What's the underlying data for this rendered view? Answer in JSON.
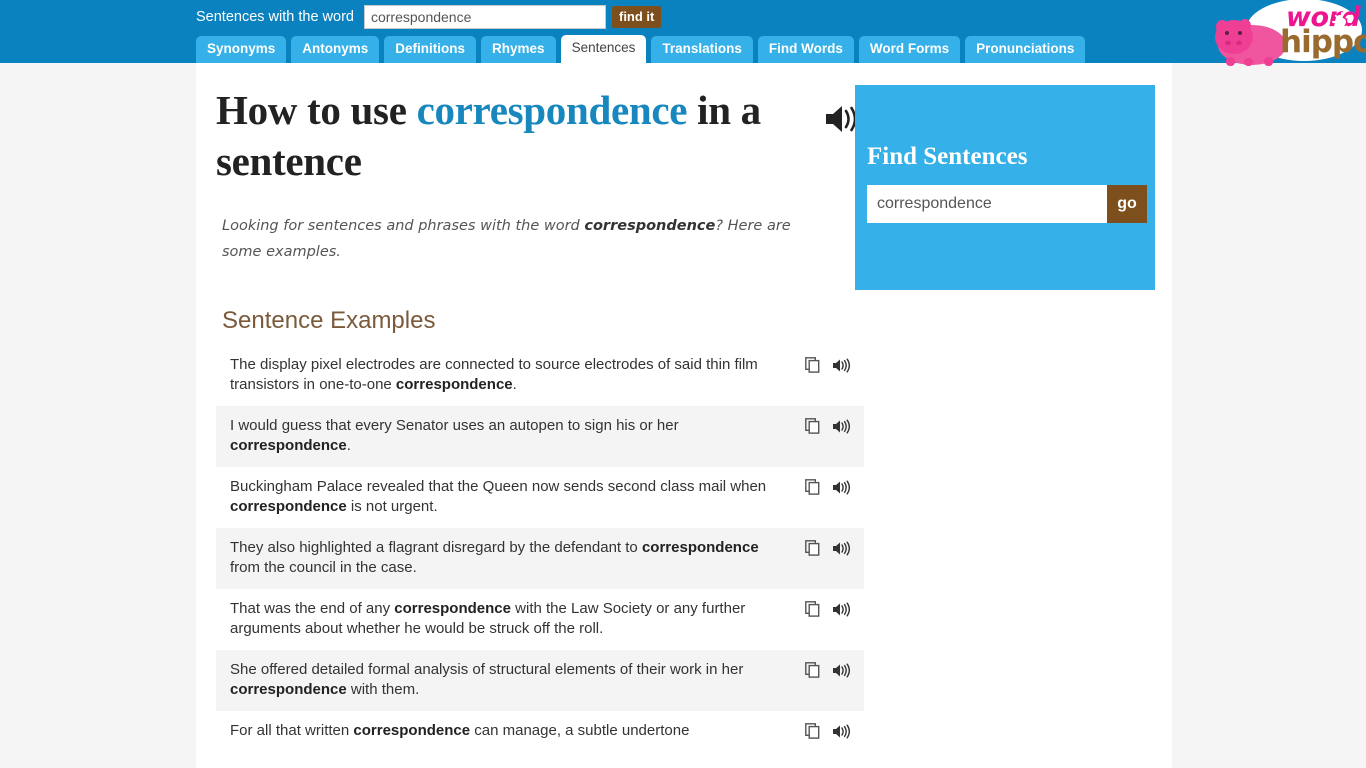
{
  "header": {
    "search_label": "Sentences with the word",
    "search_value": "correspondence",
    "search_placeholder": "correspondence",
    "find_button": "find it",
    "brightness_icon": "sun-icon",
    "logo": {
      "word": "word",
      "hippo": "hippo"
    },
    "tabs": [
      {
        "label": "Synonyms",
        "active": false
      },
      {
        "label": "Antonyms",
        "active": false
      },
      {
        "label": "Definitions",
        "active": false
      },
      {
        "label": "Rhymes",
        "active": false
      },
      {
        "label": "Sentences",
        "active": true
      },
      {
        "label": "Translations",
        "active": false
      },
      {
        "label": "Find Words",
        "active": false
      },
      {
        "label": "Word Forms",
        "active": false
      },
      {
        "label": "Pronunciations",
        "active": false
      }
    ]
  },
  "main": {
    "title_prefix": "How to use",
    "title_keyword": "correspondence",
    "title_suffix": "in a sentence",
    "title_speaker_icon": "speaker-icon",
    "lede_before": "Looking for sentences and phrases with the word ",
    "lede_keyword": "correspondence",
    "lede_after": "? Here are some examples.",
    "section_title": "Sentence Examples",
    "copy_icon": "copy-icon",
    "speaker_icon": "speaker-icon",
    "sentences": [
      {
        "before": "The display pixel electrodes are connected to source electrodes of said thin film transistors in one-to-one ",
        "keyword": "correspondence",
        "after": "."
      },
      {
        "before": "I would guess that every Senator uses an autopen to sign his or her ",
        "keyword": "correspondence",
        "after": "."
      },
      {
        "before": "Buckingham Palace revealed that the Queen now sends second class mail when ",
        "keyword": "correspondence",
        "after": " is not urgent."
      },
      {
        "before": "They also highlighted a flagrant disregard by the defendant to ",
        "keyword": "correspondence",
        "after": " from the council in the case."
      },
      {
        "before": "That was the end of any ",
        "keyword": "correspondence",
        "after": " with the Law Society or any further arguments about whether he would be struck off the roll."
      },
      {
        "before": "She offered detailed formal analysis of structural elements of their work in her ",
        "keyword": "correspondence",
        "after": " with them."
      },
      {
        "before": "For all that written ",
        "keyword": "correspondence",
        "after": " can manage, a subtle undertone"
      }
    ]
  },
  "sidebar": {
    "title": "Find Sentences",
    "input_value": "correspondence",
    "input_placeholder": "correspondence",
    "go_button": "go"
  },
  "colors": {
    "header_blue": "#0a82c0",
    "tab_blue": "#35b0e8",
    "brown": "#7d4f1d",
    "keyword_blue": "#1787bd",
    "section_brown": "#7a5a3a",
    "logo_pink": "#f0158f",
    "logo_brown": "#9a6b2f",
    "row_alt": "#f4f4f4",
    "page_bg": "#f5f5f5"
  }
}
